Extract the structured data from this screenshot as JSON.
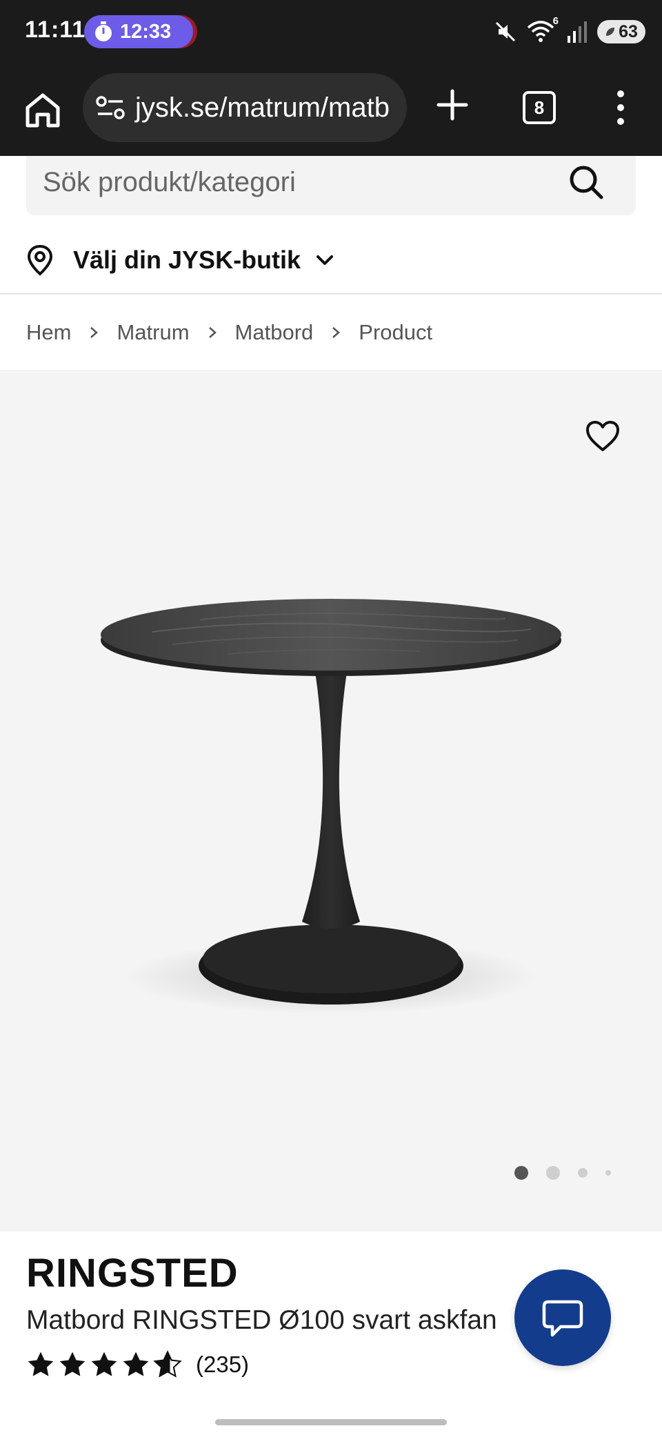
{
  "status_bar": {
    "time": "11:11",
    "timer": "12:33",
    "wifi_badge": "6",
    "battery": "63"
  },
  "browser": {
    "url": "jysk.se/matrum/matb",
    "tab_count": "8"
  },
  "search": {
    "placeholder": "Sök produkt/kategori"
  },
  "store_selector": {
    "label": "Välj din JYSK-butik"
  },
  "breadcrumb": [
    "Hem",
    "Matrum",
    "Matbord",
    "Product"
  ],
  "gallery": {
    "image_count": 4,
    "active_index": 0
  },
  "product": {
    "brand": "RINGSTED",
    "title": "Matbord RINGSTED Ø100 svart askfan",
    "rating": 4.5,
    "review_count": "(235)"
  },
  "colors": {
    "chrome_dark": "#1b1b1b",
    "timer_purple": "#6c5ce7",
    "chat_blue": "#143c8c",
    "gallery_bg": "#f4f4f4"
  }
}
